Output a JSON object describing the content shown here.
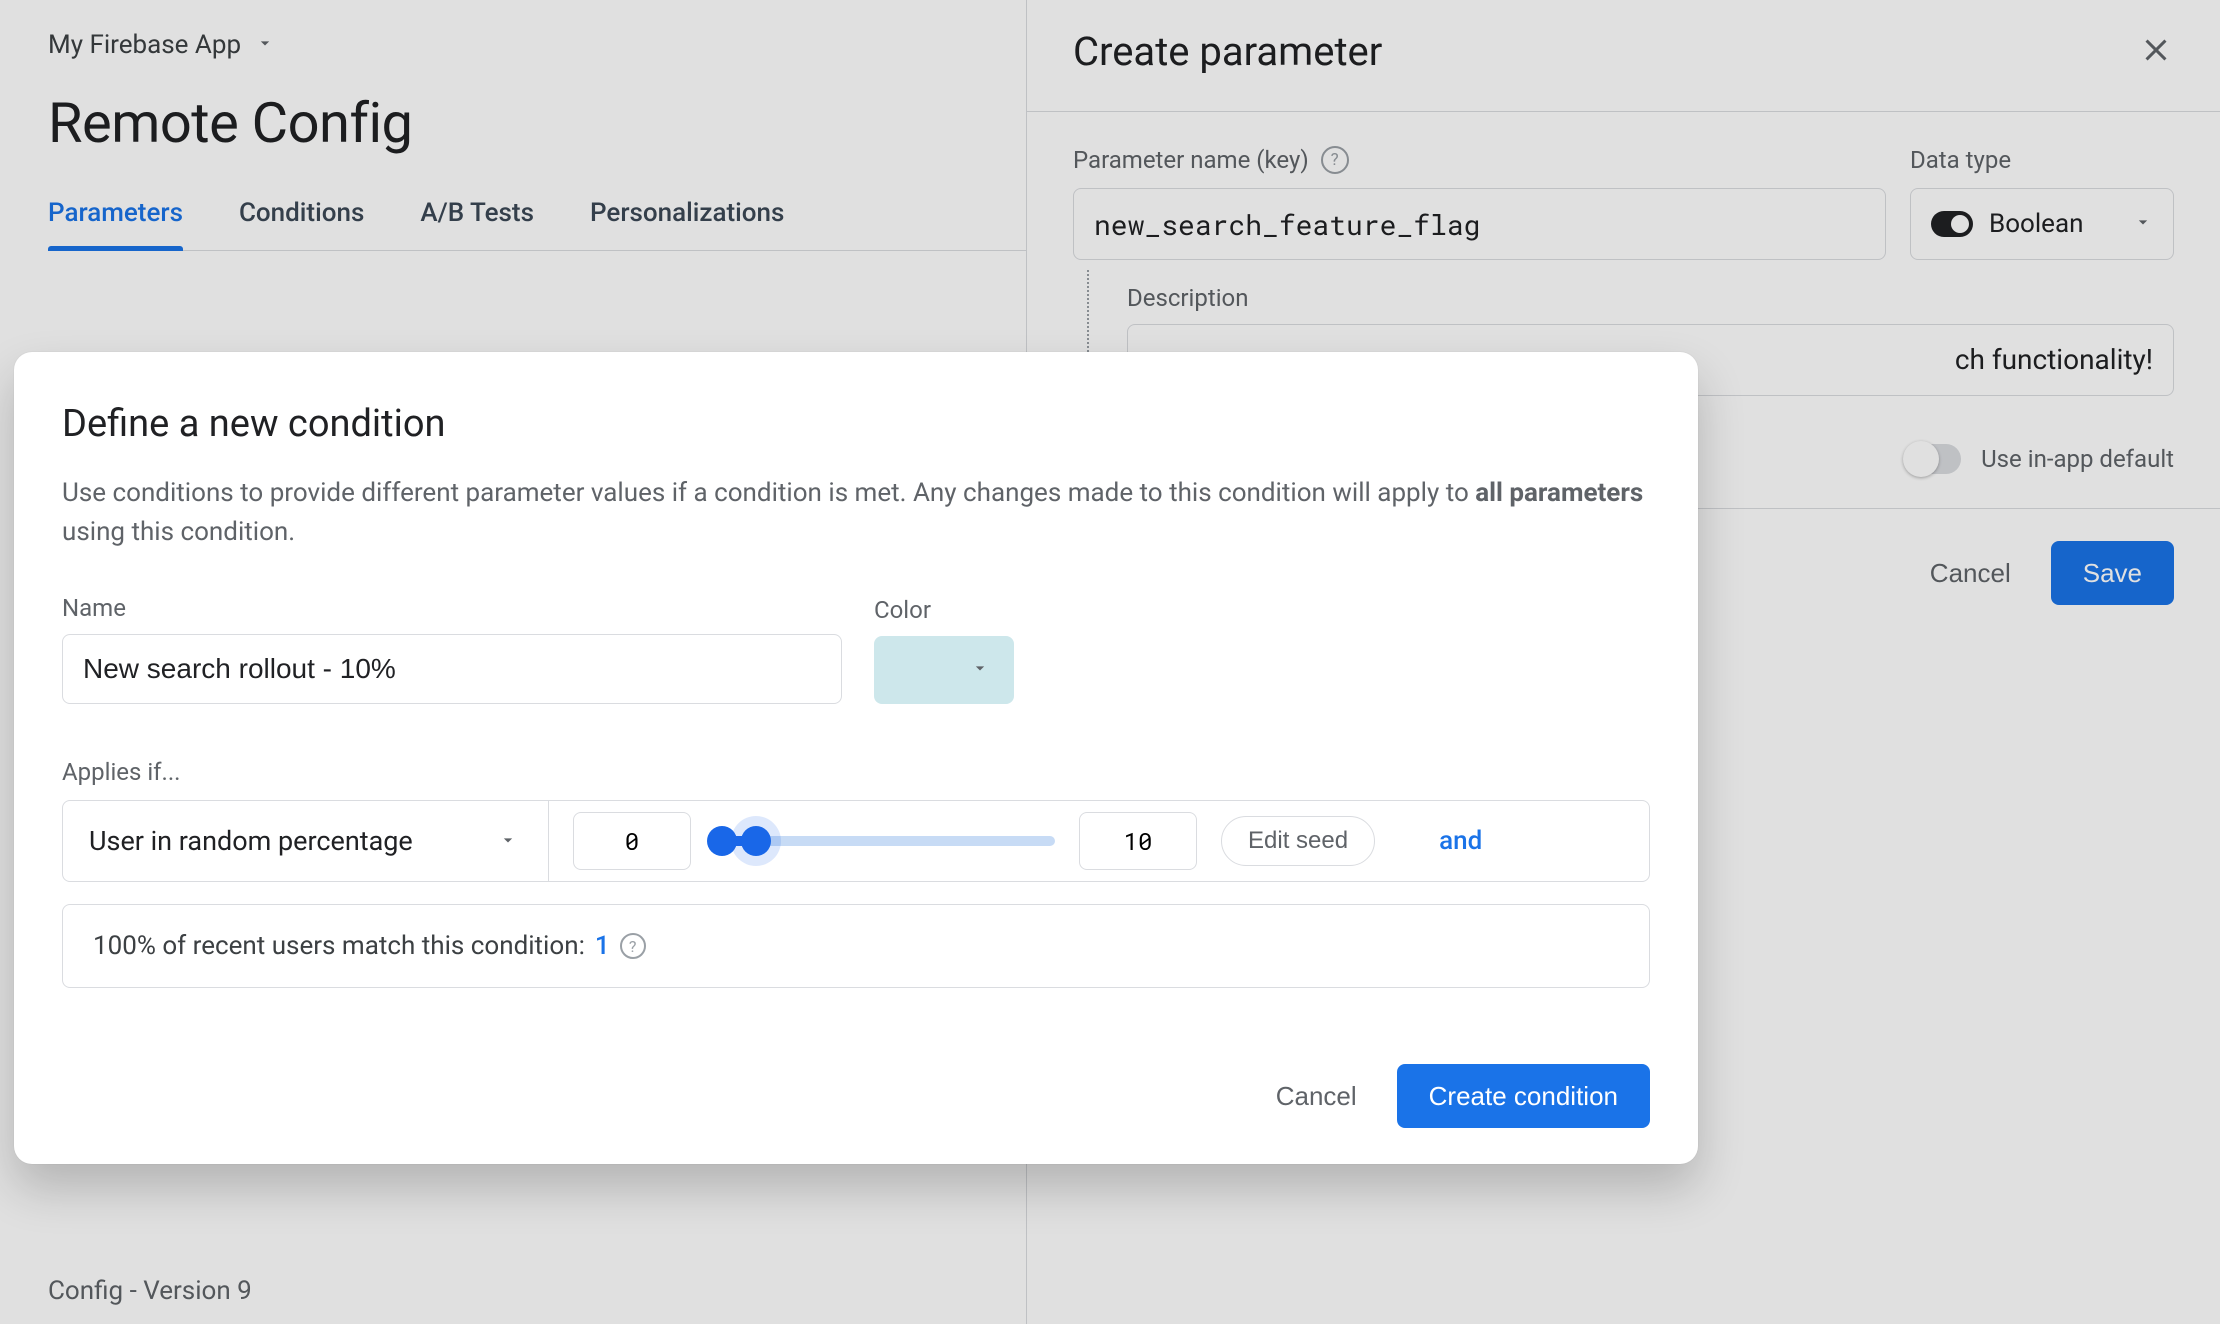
{
  "app": {
    "project_name": "My Firebase App",
    "page_title": "Remote Config",
    "version_label": "Config - Version 9"
  },
  "tabs": [
    "Parameters",
    "Conditions",
    "A/B Tests",
    "Personalizations"
  ],
  "active_tab": 0,
  "side_panel": {
    "title": "Create parameter",
    "param_key_label": "Parameter name (key)",
    "param_key_value": "new_search_feature_flag",
    "data_type_label": "Data type",
    "data_type_value": "Boolean",
    "description_label": "Description",
    "description_value_fragment": "ch functionality!",
    "use_default_label": "Use in-app default",
    "cancel": "Cancel",
    "save": "Save"
  },
  "dialog": {
    "title": "Define a new condition",
    "subtitle_prefix": "Use conditions to provide different parameter values if a condition is met. Any changes made to this condition will apply to ",
    "subtitle_bold": "all parameters",
    "subtitle_suffix": " using this condition.",
    "name_label": "Name",
    "name_value": "New search rollout - 10%",
    "color_label": "Color",
    "color_value": "#cde7eb",
    "applies_label": "Applies if...",
    "rule_type": "User in random percentage",
    "range_low": "0",
    "range_high": "10",
    "edit_seed": "Edit seed",
    "and_label": "and",
    "match_text": "100% of recent users match this condition: ",
    "match_count": "1",
    "cancel": "Cancel",
    "create": "Create condition"
  }
}
